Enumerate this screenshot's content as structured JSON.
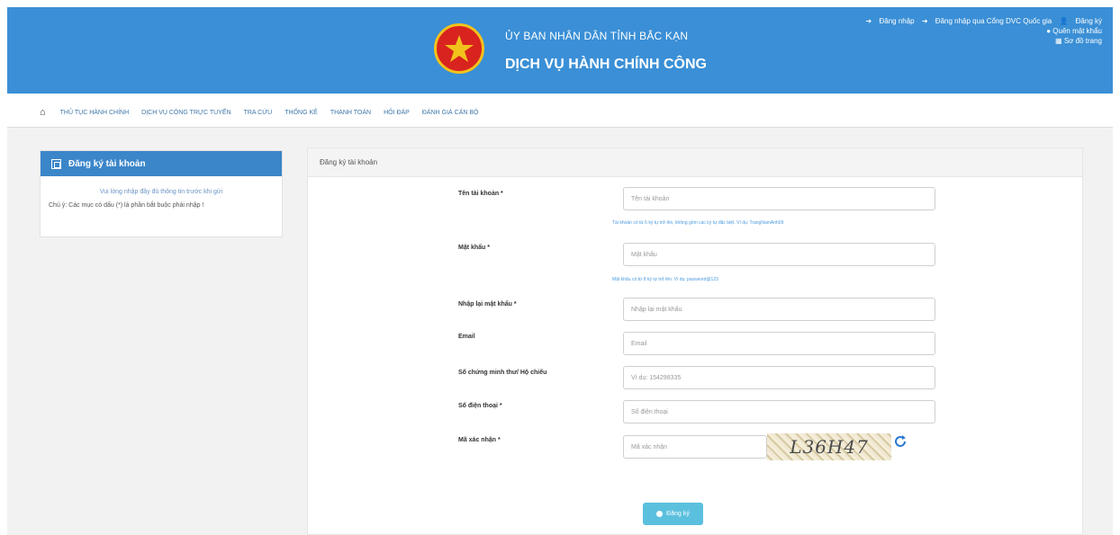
{
  "header": {
    "agency": "ỦY BAN NHÂN DÂN TỈNH BẮC KẠN",
    "service": "DỊCH VỤ HÀNH CHÍNH CÔNG",
    "links": {
      "login": "Đăng nhập",
      "login_portal": "Đăng nhập qua Cổng DVC Quốc gia",
      "register": "Đăng ký",
      "forgot": "Quên mật khẩu",
      "sitemap": "Sơ đồ trang"
    }
  },
  "nav": {
    "items": [
      "THỦ TỤC HÀNH CHÍNH",
      "DỊCH VỤ CÔNG TRỰC TUYẾN",
      "TRA CỨU",
      "THỐNG KÊ",
      "THANH TOÁN",
      "HỎI ĐÁP",
      "ĐÁNH GIÁ CÁN BỘ"
    ]
  },
  "sidebar": {
    "title": "Đăng ký tài khoản",
    "line1": "Vui lòng nhập đầy đủ thông tin trước khi gửi",
    "line2": "Chú ý: Các mục có dấu (*) là phần bắt buộc phải nhập !"
  },
  "form": {
    "title": "Đăng ký tài khoản",
    "username_label": "Tên tài khoản *",
    "username_placeholder": "Tên tài khoản",
    "username_hint": "Tài khoản có từ 6 ký tự trở lên, không gồm các ký tự đặc biệt. Ví dụ: TrangNamAnh09",
    "password_label": "Mật khẩu *",
    "password_placeholder": "Mật khẩu",
    "password_hint": "Mật khẩu có từ 8 ký tự trở lên. Ví dụ: password@123",
    "confirm_label": "Nhập lại mật khẩu *",
    "confirm_placeholder": "Nhập lại mật khẩu",
    "email_label": "Email",
    "email_placeholder": "Email",
    "id_label": "Số chứng minh thư/ Hộ chiếu",
    "id_placeholder": "Ví dụ: 154298335",
    "phone_label": "Số điện thoại *",
    "phone_placeholder": "Số điện thoại",
    "captcha_label": "Mã xác nhận *",
    "captcha_placeholder": "Mã xác nhận",
    "captcha_text": "L36H47",
    "submit_label": "Đăng ký"
  },
  "colors": {
    "header_bg": "#3a8fd6",
    "submit_bg": "#5bc0de"
  }
}
